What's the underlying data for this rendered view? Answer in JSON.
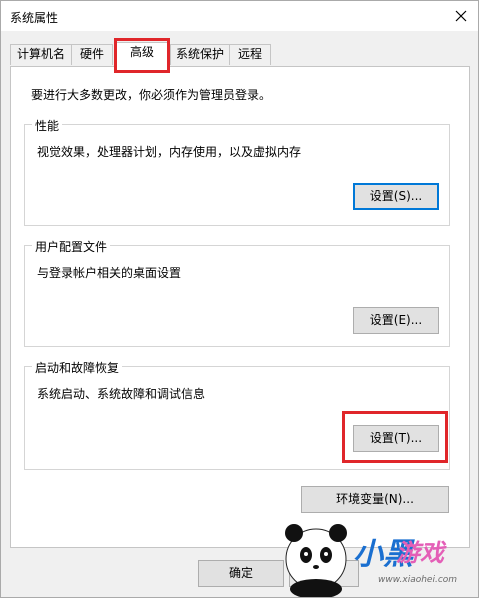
{
  "window": {
    "title": "系统属性"
  },
  "tabs": [
    {
      "label": "计算机名",
      "active": false
    },
    {
      "label": "硬件",
      "active": false
    },
    {
      "label": "高级",
      "active": true
    },
    {
      "label": "系统保护",
      "active": false
    },
    {
      "label": "远程",
      "active": false
    }
  ],
  "notice": "要进行大多数更改，你必须作为管理员登录。",
  "groups": {
    "performance": {
      "title": "性能",
      "description": "视觉效果，处理器计划，内存使用，以及虚拟内存",
      "button": "设置(S)..."
    },
    "user_profiles": {
      "title": "用户配置文件",
      "description": "与登录帐户相关的桌面设置",
      "button": "设置(E)..."
    },
    "startup_recovery": {
      "title": "启动和故障恢复",
      "description": "系统启动、系统故障和调试信息",
      "button": "设置(T)..."
    }
  },
  "env_button": "环境变量(N)...",
  "footer": {
    "ok_label": "确定"
  },
  "watermark": {
    "brand_a": "小黑",
    "brand_b": "游戏",
    "url": "www.xiaohei.com"
  },
  "colors": {
    "highlight": "#e0262a",
    "accent": "#0078d7"
  }
}
